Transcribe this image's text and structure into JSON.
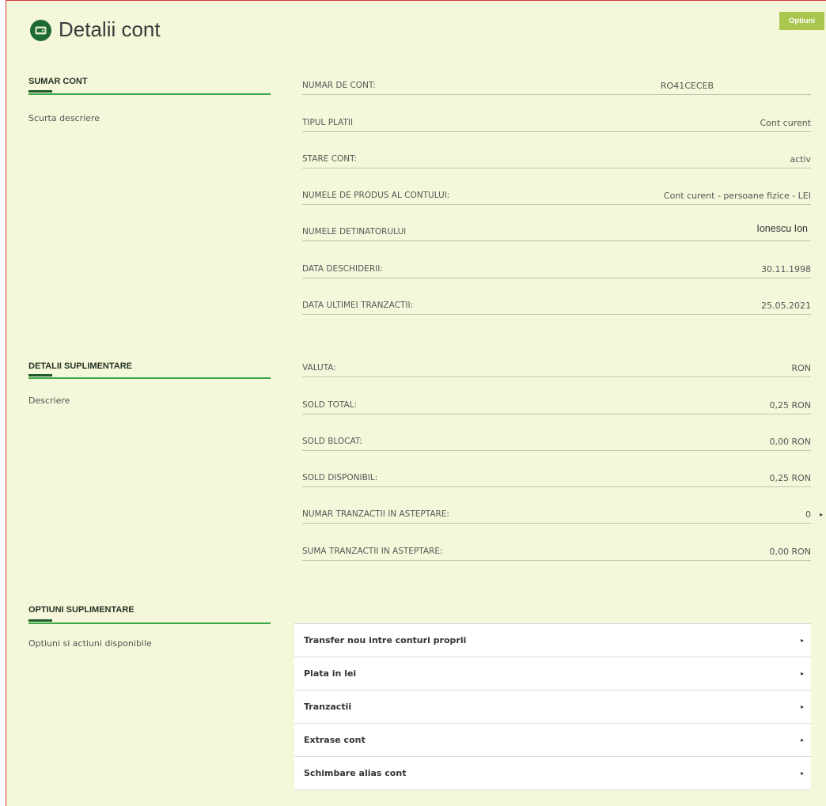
{
  "header": {
    "title": "Detalii cont",
    "title_icon": "account-card-icon",
    "options_button": "Optiuni"
  },
  "summary": {
    "heading": "SUMAR CONT",
    "description": "Scurta descriere",
    "rows": [
      {
        "label": "NUMAR DE CONT:",
        "value": "RO41CECEB"
      },
      {
        "label": "TIPUL PLATII",
        "value": "Cont curent"
      },
      {
        "label": "STARE CONT:",
        "value": "activ"
      },
      {
        "label": "NUMELE DE PRODUS AL CONTULUI:",
        "value": "Cont curent - persoane fizice - LEI"
      },
      {
        "label": "NUMELE DETINATORULUI",
        "value": "Ionescu Ion"
      },
      {
        "label": "DATA DESCHIDERII:",
        "value": "30.11.1998"
      },
      {
        "label": "DATA ULTIMEI TRANZACTII:",
        "value": "25.05.2021"
      }
    ]
  },
  "details": {
    "heading": "DETALII SUPLIMENTARE",
    "description": "Descriere",
    "rows": [
      {
        "label": "VALUTA:",
        "value": "RON"
      },
      {
        "label": "SOLD TOTAL:",
        "value": "0,25 RON"
      },
      {
        "label": "SOLD BLOCAT:",
        "value": "0,00 RON"
      },
      {
        "label": "SOLD DISPONIBIL:",
        "value": "0,25 RON"
      },
      {
        "label": "NUMAR TRANZACTII IN ASTEPTARE:",
        "value": "0",
        "action_icon": "caret-right-icon"
      },
      {
        "label": "SUMA TRANZACTII IN ASTEPTARE:",
        "value": "0,00 RON"
      }
    ]
  },
  "options": {
    "heading": "OPTIUNI SUPLIMENTARE",
    "description": "Optiuni si actiuni disponibile",
    "item_icon": "caret-right-icon",
    "items": [
      {
        "label": "Transfer nou intre conturi proprii"
      },
      {
        "label": "Plata in lei"
      },
      {
        "label": "Tranzactii"
      },
      {
        "label": "Extrase cont"
      },
      {
        "label": "Schimbare alias cont"
      }
    ]
  },
  "colors": {
    "background": "#f5f7da",
    "accent": "#3ba845",
    "accent_dark": "#1d5a2a",
    "button": "#a9c64f",
    "frame_border": "#d43a3a",
    "icon": "#1f6a34"
  }
}
